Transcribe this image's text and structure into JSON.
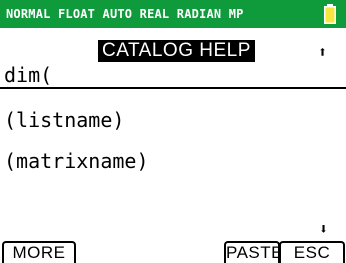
{
  "status_bar": {
    "mode_text": "NORMAL FLOAT AUTO REAL RADIAN MP",
    "battery_icon": "battery-icon",
    "background_color": "#0f9a3c",
    "battery_color": "#f5e642"
  },
  "header": {
    "title": "CATALOG HELP",
    "up_arrow": "⬆",
    "up_arrow_icon": "scroll-up-arrow-icon"
  },
  "function": {
    "name": "dim("
  },
  "arguments": [
    "(listname)",
    "(matrixname)"
  ],
  "scroll": {
    "down_arrow": "⬇",
    "down_arrow_icon": "scroll-down-arrow-icon"
  },
  "softkeys": {
    "more": "MORE",
    "paste": "PASTE",
    "esc": "ESC"
  }
}
